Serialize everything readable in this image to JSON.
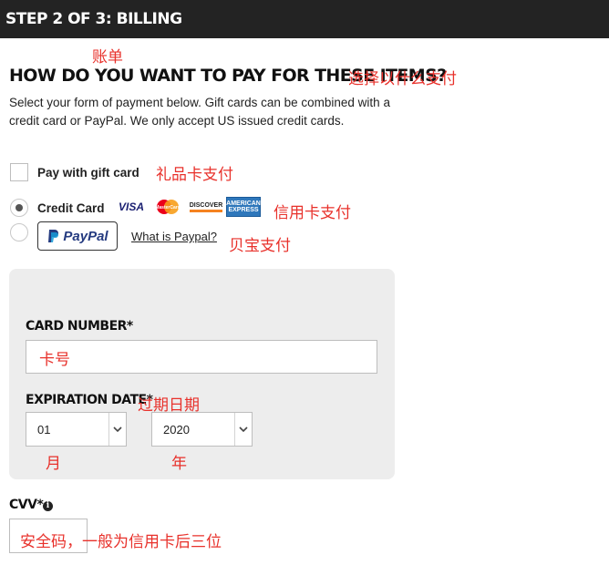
{
  "header": {
    "title": "STEP 2 OF 3: BILLING"
  },
  "annotations": {
    "billing": "账单",
    "choose_payment": "选择以什么支付",
    "gift_card_pay": "礼品卡支付",
    "credit_card_pay": "信用卡支付",
    "paypal_pay": "贝宝支付",
    "card_number": "卡号",
    "expiration_date": "过期日期",
    "month": "月",
    "year": "年",
    "cvv": "安全码，一般为信用卡后三位"
  },
  "payment": {
    "heading": "HOW DO YOU WANT TO PAY FOR THESE ITEMS?",
    "description": "Select your form of payment below. Gift cards can be combined with a credit card or PayPal. We only accept US issued credit cards.",
    "gift_card_label": "Pay with gift card",
    "credit_card_label": "Credit Card",
    "paypal_logo": "PayPal",
    "paypal_link": "What is Paypal?",
    "selected": "credit_card",
    "card_brands": [
      "VISA",
      "MasterCard",
      "DISCOVER",
      "AMERICAN EXPRESS"
    ]
  },
  "card_form": {
    "card_number_label": "CARD NUMBER*",
    "expiration_label": "EXPIRATION DATE*",
    "month_value": "01",
    "year_value": "2020",
    "cvv_label": "CVV*",
    "info_glyph": "i"
  },
  "colors": {
    "topbar": "#232323",
    "annotation": "#e8312b",
    "panel": "#ededed",
    "amex": "#2e77bb",
    "visa": "#1a1f71",
    "paypal": "#253b80"
  }
}
